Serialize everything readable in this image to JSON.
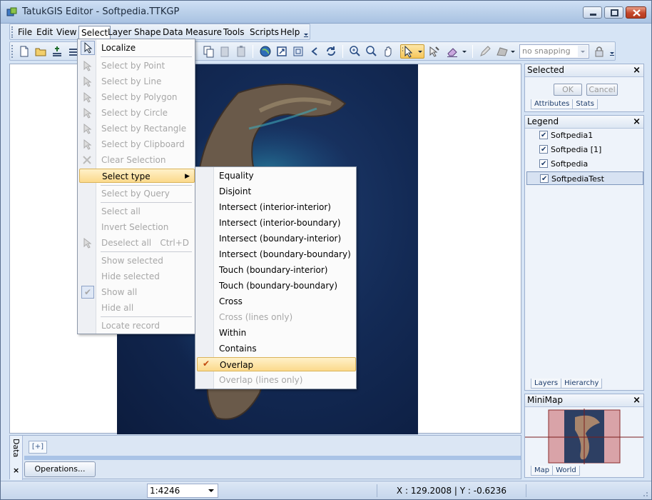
{
  "window": {
    "title": "TatukGIS Editor - Softpedia.TTKGP"
  },
  "menubar": {
    "items": [
      "File",
      "Edit",
      "View",
      "Select",
      "Layer",
      "Shape",
      "Data",
      "Measure",
      "Tools",
      "Scripts",
      "Help"
    ],
    "active": "Select"
  },
  "toolbar": {
    "snapping": "no snapping"
  },
  "select_menu": {
    "items": [
      {
        "label": "Localize",
        "disabled": false,
        "icon": "select-arrow-icon"
      },
      {
        "label": "Select by Point",
        "disabled": true,
        "icon": "select-point-icon"
      },
      {
        "label": "Select by Line",
        "disabled": true,
        "icon": "select-line-icon"
      },
      {
        "label": "Select by Polygon",
        "disabled": true,
        "icon": "select-polygon-icon"
      },
      {
        "label": "Select by Circle",
        "disabled": true,
        "icon": "select-circle-icon"
      },
      {
        "label": "Select by Rectangle",
        "disabled": true,
        "icon": "select-rectangle-icon"
      },
      {
        "label": "Select by Clipboard",
        "disabled": true,
        "icon": "select-clipboard-icon"
      },
      {
        "label": "Clear Selection",
        "disabled": true,
        "icon": "clear-selection-icon"
      },
      {
        "label": "Select type",
        "disabled": false,
        "submenu": true
      },
      {
        "label": "Select by Query",
        "disabled": true
      },
      {
        "label": "Select all",
        "disabled": true
      },
      {
        "label": "Invert Selection",
        "disabled": true
      },
      {
        "label": "Deselect all",
        "shortcut": "Ctrl+D",
        "disabled": true,
        "icon": "deselect-icon"
      },
      {
        "label": "Show selected",
        "disabled": true
      },
      {
        "label": "Hide selected",
        "disabled": true
      },
      {
        "label": "Show all",
        "disabled": true,
        "checked": true
      },
      {
        "label": "Hide all",
        "disabled": true
      },
      {
        "label": "Locate record",
        "disabled": true
      }
    ]
  },
  "select_type_menu": {
    "items": [
      {
        "label": "Equality",
        "disabled": false
      },
      {
        "label": "Disjoint",
        "disabled": false
      },
      {
        "label": "Intersect (interior-interior)",
        "disabled": false
      },
      {
        "label": "Intersect (interior-boundary)",
        "disabled": false
      },
      {
        "label": "Intersect (boundary-interior)",
        "disabled": false
      },
      {
        "label": "Intersect (boundary-boundary)",
        "disabled": false
      },
      {
        "label": "Touch (boundary-interior)",
        "disabled": false
      },
      {
        "label": "Touch (boundary-boundary)",
        "disabled": false
      },
      {
        "label": "Cross",
        "disabled": false
      },
      {
        "label": "Cross (lines only)",
        "disabled": true
      },
      {
        "label": "Within",
        "disabled": false
      },
      {
        "label": "Contains",
        "disabled": false
      },
      {
        "label": "Overlap",
        "disabled": false,
        "checked": true
      },
      {
        "label": "Overlap (lines only)",
        "disabled": true
      }
    ]
  },
  "selected_panel": {
    "title": "Selected",
    "ok": "OK",
    "cancel": "Cancel",
    "tabs": [
      "Attributes",
      "Stats"
    ]
  },
  "legend_panel": {
    "title": "Legend",
    "layers": [
      {
        "name": "Softpedia1",
        "checked": true
      },
      {
        "name": "Softpedia [1]",
        "checked": true
      },
      {
        "name": "Softpedia",
        "checked": true
      },
      {
        "name": "SoftpediaTest",
        "checked": true,
        "selected": true
      }
    ],
    "tabs": [
      "Layers",
      "Hierarchy"
    ]
  },
  "minimap_panel": {
    "title": "MiniMap",
    "tabs": [
      "Map",
      "World"
    ]
  },
  "data_panel": {
    "tab_label": "Data",
    "add_label": "[+]",
    "operations": "Operations..."
  },
  "statusbar": {
    "scale": "1:4246",
    "coords": "X : 129.2008 | Y : -0.6236"
  },
  "colors": {
    "highlight": "#fbd98b",
    "frame": "#d6e4f5",
    "map_water": "#132a55"
  }
}
